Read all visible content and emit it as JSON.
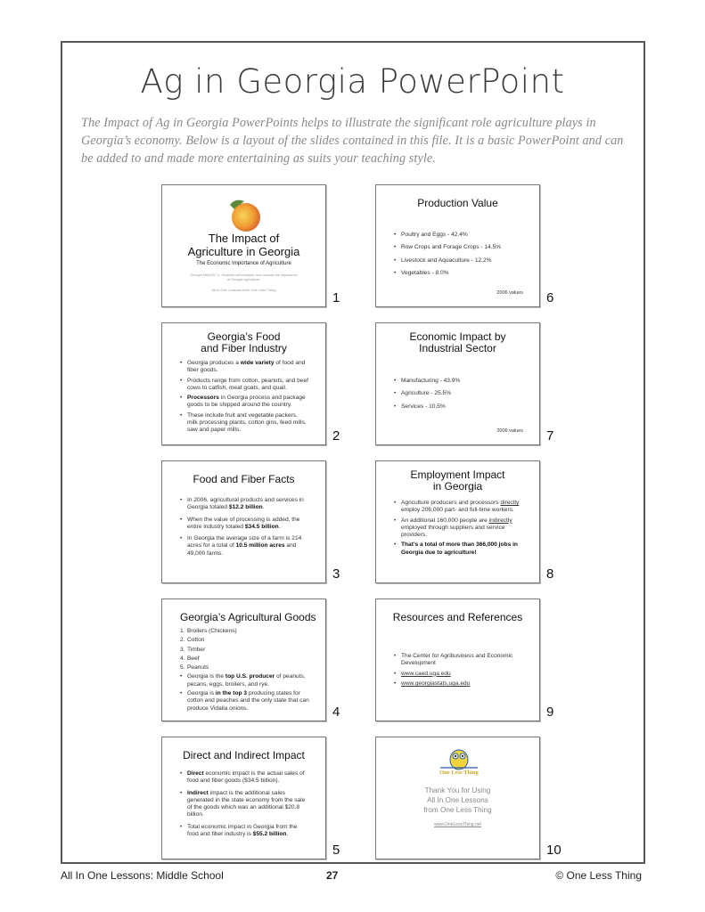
{
  "header": {
    "title": "Ag in Georgia PowerPoint",
    "intro": "The Impact of Ag in Georgia PowerPoints helps to illustrate the significant role agriculture plays in Georgia’s economy. Below is a layout of the slides contained in this file. It is a basic PowerPoint and can be added to and made more entertaining as suits your teaching style."
  },
  "slides": {
    "s1": {
      "number": "1",
      "image_icon": "peach-icon",
      "title_line1": "The Impact of",
      "title_line2": "Agriculture in Georgia",
      "subtitle": "The Economic Importance of Agriculture",
      "standard": "Georgia M6AG07-2: Students will compare and contrast the importance of Georgia agriculture.",
      "credit": "All In One Lessons from One Less Thing"
    },
    "s2": {
      "number": "2",
      "title_line1": "Georgia’s Food",
      "title_line2": "and Fiber Industry",
      "b1_pre": "Georgia produces a ",
      "b1_bold": "wide variety",
      "b1_post": " of food and fiber goods.",
      "b2": "Products range from cotton, peanuts, and beef cows to catfish, meat goats, and quail.",
      "b3_bold": "Processors",
      "b3_post": " in Georgia process and package goods to be shipped around the country.",
      "b4": "These include fruit and vegetable packers, milk processing plants, cotton gins, feed mills, saw and paper mills."
    },
    "s3": {
      "number": "3",
      "title": "Food and Fiber Facts",
      "b1_pre": "In 2006, agricultural products and services in Georgia totaled ",
      "b1_bold": "$12.2 billion",
      "b1_post": ".",
      "b2_pre": "When the value of processing is added, the entire industry totaled ",
      "b2_bold": "$34.5 billion",
      "b2_post": ".",
      "b3_pre": "In Georgia the average size of a farm is 214 acres for a total of ",
      "b3_bold": "10.5 million acres",
      "b3_post": " and 49,000 farms."
    },
    "s4": {
      "number": "4",
      "title": "Georgia’s Agricultural Goods",
      "ranked": [
        {
          "n": "1.",
          "label": "Broilers (Chickens)"
        },
        {
          "n": "2.",
          "label": "Cotton"
        },
        {
          "n": "3.",
          "label": "Timber"
        },
        {
          "n": "4.",
          "label": "Beef"
        },
        {
          "n": "5.",
          "label": "Peanuts"
        }
      ],
      "b1_pre": "Georgia is the ",
      "b1_bold": "top U.S. producer",
      "b1_post": " of peanuts, pecans, eggs, broilers, and rye.",
      "b2_pre": "Georgia is ",
      "b2_bold": "in the top 3",
      "b2_post": " producing states for cotton and peaches and the only state that can produce Vidalia onions."
    },
    "s5": {
      "number": "5",
      "title": "Direct and Indirect Impact",
      "b1_bold": "Direct",
      "b1_post": " economic impact is the actual sales of food and fiber goods ($34.5 billion).",
      "b2_bold": "Indirect",
      "b2_post": " impact is the additional sales generated in the state economy from the sale of the goods which was an additional $20.8 billion.",
      "b3_pre": "Total economic impact in Georgia from the food and fiber industry is ",
      "b3_bold": "$55.2 billion",
      "b3_post": "."
    },
    "s6": {
      "number": "6",
      "title": "Production Value",
      "items": [
        "Poultry and Eggs - 42.4%",
        "Row Crops and Forage Crops - 14.5%",
        "Livestock and Aquaculture - 12.2%",
        "Vegetables - 8.0%"
      ],
      "note": "2006 values"
    },
    "s7": {
      "number": "7",
      "title_line1": "Economic Impact by",
      "title_line2": "Industrial Sector",
      "items": [
        "Manufacturing - 43.9%",
        "Agriculture - 25.5%",
        "Services - 10.5%"
      ],
      "note": "2006 values"
    },
    "s8": {
      "number": "8",
      "title_line1": "Employment Impact",
      "title_line2": "in Georgia",
      "b1_pre": "Agriculture producers and processors ",
      "b1_u": "directly",
      "b1_post": " employ 206,000 part- and full-time workers.",
      "b2_pre": "An additional 160,000 people are ",
      "b2_u": "indirectly",
      "b2_post": " employed through suppliers and service providers.",
      "b3_bold": "That’s a total of more than 366,000 jobs in Georgia due to agriculture!"
    },
    "s9": {
      "number": "9",
      "title": "Resources and References",
      "items": [
        "The Center for Agribusiness and Economic Development"
      ],
      "links": [
        "www.caed.uga.edu",
        "www.georgiastats.uga.edu"
      ]
    },
    "s10": {
      "number": "10",
      "logo_icon": "owl-logo-icon",
      "logo_text": "One Less Thing",
      "line1": "Thank You for Using",
      "line2": "All In One Lessons",
      "line3": "from One Less Thing",
      "link": "www.OneLessThing.net"
    }
  },
  "footer": {
    "left": "All In One Lessons: Middle School",
    "page": "27",
    "right": "© One Less Thing"
  },
  "colors": {
    "title": "#3a3a3a",
    "intro": "#888888",
    "frame": "#555555",
    "peach": "#f2a23a",
    "owl_yellow": "#f4d33c",
    "owl_blue": "#2a5aa8"
  }
}
